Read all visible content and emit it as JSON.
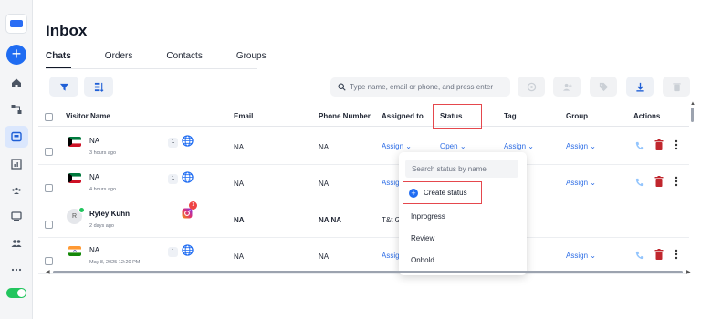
{
  "page": {
    "title": "Inbox"
  },
  "tabs": [
    "Chats",
    "Orders",
    "Contacts",
    "Groups"
  ],
  "search": {
    "placeholder": "Type name, email or phone, and press enter"
  },
  "columns": {
    "visitor_name": "Visitor Name",
    "email": "Email",
    "phone_number": "Phone Number",
    "assigned_to": "Assigned to",
    "status": "Status",
    "tag": "Tag",
    "group": "Group",
    "actions": "Actions"
  },
  "rows": [
    {
      "name": "NA",
      "time": "3 hours ago",
      "count": "1",
      "email": "NA",
      "phone": "NA",
      "assigned": "Assign",
      "status": "Open",
      "tag": "Assign",
      "group": "Assign"
    },
    {
      "name": "NA",
      "time": "4 hours ago",
      "count": "1",
      "email": "NA",
      "phone": "NA",
      "assigned": "Assig",
      "status": "",
      "tag": "",
      "group": "Assign"
    },
    {
      "name": "Ryley Kuhn",
      "time": "2 days ago",
      "avatar": "R",
      "notif": "1",
      "email": "NA",
      "phone": "NA NA",
      "assigned": "T&t G",
      "status": "",
      "tag": "",
      "group": ""
    },
    {
      "name": "NA",
      "time": "May 8, 2025 12:20 PM",
      "count": "1",
      "email": "NA",
      "phone": "NA",
      "assigned": "Assig",
      "status": "",
      "tag": "",
      "group": "Assign"
    }
  ],
  "status_dropdown": {
    "search_placeholder": "Search status by name",
    "create_label": "Create status",
    "items": [
      "Inprogress",
      "Review",
      "Onhold"
    ]
  },
  "colors": {
    "accent": "#1f6cf2",
    "link": "#2e6ee6",
    "danger": "#c0262d",
    "highlight": "#e5484d"
  }
}
